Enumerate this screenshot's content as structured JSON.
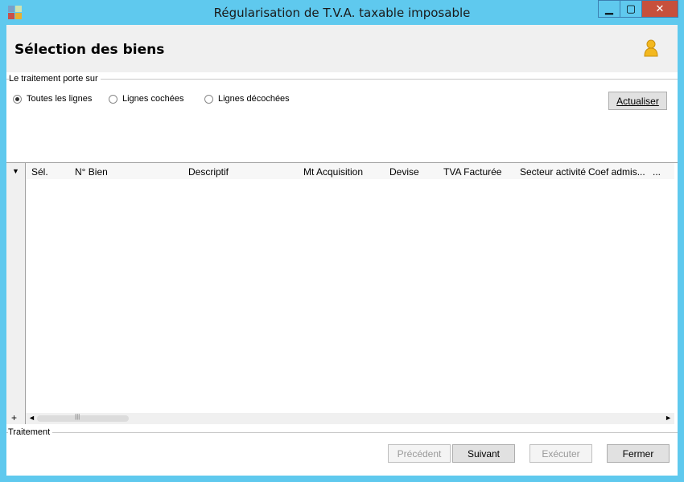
{
  "window": {
    "title": "Régularisation de T.V.A. taxable imposable",
    "controls": {
      "minimize": "▁",
      "maximize": "▢",
      "close": "✕"
    }
  },
  "header": {
    "title": "Sélection des biens",
    "user_icon": "user-icon"
  },
  "scope_group": {
    "label": "Le traitement porte sur",
    "options": [
      {
        "label": "Toutes les lignes",
        "checked": true
      },
      {
        "label": "Lignes cochées",
        "checked": false
      },
      {
        "label": "Lignes décochées",
        "checked": false
      }
    ],
    "refresh_button": "Actualiser"
  },
  "grid": {
    "indicator": "▼",
    "columns": [
      "Sél.",
      "N° Bien",
      "Descriptif",
      "Mt Acquisition",
      "Devise",
      "TVA Facturée",
      "Secteur activité",
      "Coef admis...",
      "..."
    ],
    "rows": [],
    "add_row": "+",
    "scroll_left": "◄",
    "scroll_right": "►",
    "thumb_grip": "|||"
  },
  "footer": {
    "section_label": "Traitement",
    "buttons": {
      "previous": "Précédent",
      "next": "Suivant",
      "execute": "Exécuter",
      "close": "Fermer"
    }
  },
  "colors": {
    "title_bar": "#5fc9ee",
    "close_button": "#c7503c",
    "panel": "#f0f0f0"
  }
}
